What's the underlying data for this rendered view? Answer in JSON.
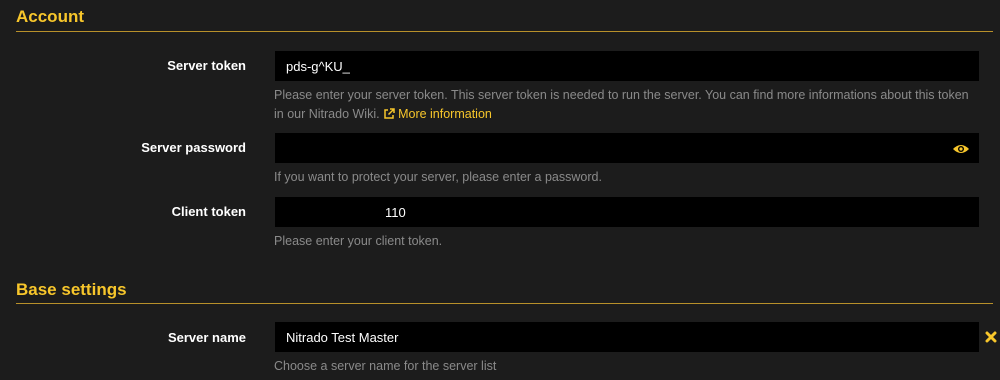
{
  "account": {
    "title": "Account",
    "server_token": {
      "label": "Server token",
      "value": "pds-g^KU_",
      "help": "Please enter your server token. This server token is needed to run the server. You can find more informations about this token in our Nitrado Wiki.",
      "link_label": "More information",
      "link_icon": "external-link-icon"
    },
    "server_password": {
      "label": "Server password",
      "value": "",
      "help": "If you want to protect your server, please enter a password.",
      "toggle_icon": "eye-icon"
    },
    "client_token": {
      "label": "Client token",
      "value": "110",
      "help": "Please enter your client token."
    }
  },
  "base_settings": {
    "title": "Base settings",
    "server_name": {
      "label": "Server name",
      "value": "Nitrado Test Master",
      "help": "Choose a server name for the server list",
      "clear_icon": "close-icon"
    }
  },
  "colors": {
    "accent": "#f7c62b",
    "background": "#1c1c1c",
    "field_background": "#000000",
    "help_text": "#8a8a8a"
  }
}
